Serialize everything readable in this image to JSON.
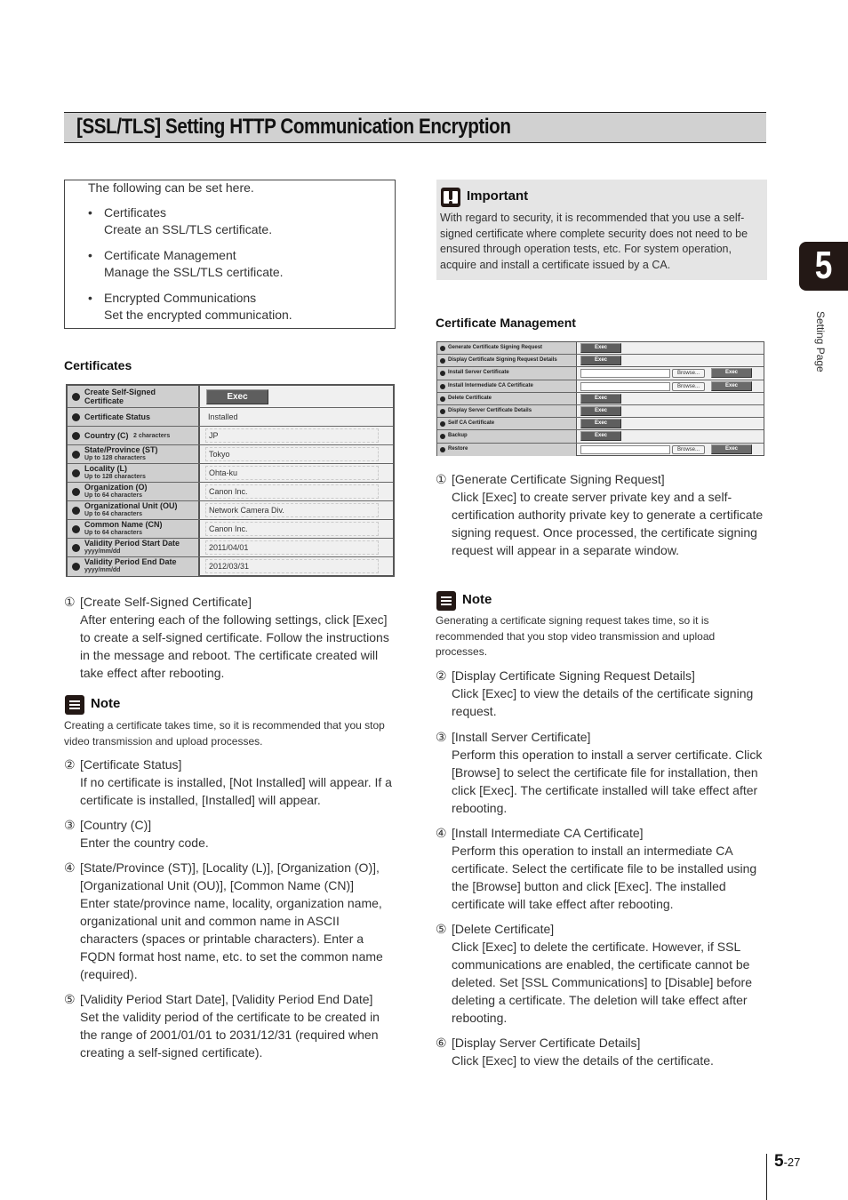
{
  "header": {
    "title": "[SSL/TLS] Setting HTTP Communication Encryption"
  },
  "chapter": {
    "number": "5",
    "side_label": "Setting Page"
  },
  "intro": {
    "lead": "The following can be set here.",
    "bullets": [
      {
        "title": "Certificates",
        "desc": "Create an SSL/TLS certificate."
      },
      {
        "title": "Certificate Management",
        "desc": "Manage the SSL/TLS certificate."
      },
      {
        "title": "Encrypted Communications",
        "desc": "Set the encrypted communication."
      }
    ]
  },
  "certificates": {
    "heading": "Certificates",
    "rows": [
      {
        "label": "Create Self-Signed",
        "label2": "Certificate",
        "sub": "",
        "type": "button",
        "value": "Exec"
      },
      {
        "label": "Certificate Status",
        "sub": "",
        "type": "text",
        "value": "Installed"
      },
      {
        "label": "Country (C)",
        "inline_sub": "2 characters",
        "sub": "",
        "type": "field",
        "value": "JP"
      },
      {
        "label": "State/Province (ST)",
        "sub": "Up to 128 characters",
        "type": "field",
        "value": "Tokyo"
      },
      {
        "label": "Locality (L)",
        "sub": "Up to 128 characters",
        "type": "field",
        "value": "Ohta-ku"
      },
      {
        "label": "Organization (O)",
        "sub": "Up to 64 characters",
        "type": "field",
        "value": "Canon Inc."
      },
      {
        "label": "Organizational Unit (OU)",
        "sub": "Up to 64 characters",
        "type": "field",
        "value": "Network Camera Div."
      },
      {
        "label": "Common Name (CN)",
        "sub": "Up to 64 characters",
        "type": "field",
        "value": "Canon Inc."
      },
      {
        "label": "Validity Period Start Date",
        "sub": "yyyy/mm/dd",
        "type": "field",
        "value": "2011/04/01"
      },
      {
        "label": "Validity Period End Date",
        "sub": "yyyy/mm/dd",
        "type": "field",
        "value": "2012/03/31"
      }
    ]
  },
  "left_items": [
    {
      "num": "①",
      "title": "[Create Self-Signed Certificate]",
      "body": "After entering each of the following settings, click [Exec] to create a self-signed certificate. Follow the instructions in the message and reboot. The certificate created will take effect after rebooting."
    },
    {
      "num": "②",
      "title": "[Certificate Status]",
      "body": "If no certificate is installed, [Not Installed] will appear. If a certificate is installed, [Installed] will appear."
    },
    {
      "num": "③",
      "title": "[Country (C)]",
      "body": "Enter the country code."
    },
    {
      "num": "④",
      "title": "[State/Province (ST)], [Locality (L)], [Organization (O)], [Organizational Unit (OU)], [Common Name (CN)]",
      "body": "Enter state/province name, locality, organization name, organizational unit and common name in ASCII characters (spaces or printable characters). Enter a FQDN format host name, etc. to set the common name (required)."
    },
    {
      "num": "⑤",
      "title": "[Validity Period Start Date], [Validity Period End Date]",
      "body": "Set the validity period of the certificate to be created in the range of 2001/01/01 to 2031/12/31 (required when creating a self-signed certificate)."
    }
  ],
  "left_note": {
    "title": "Note",
    "text": "Creating a certificate takes time, so it is recommended that you stop video transmission and upload processes."
  },
  "important": {
    "title": "Important",
    "text": "With regard to security, it is recommended that you use a self-signed certificate where complete security does not need to be ensured through operation tests, etc. For system operation, acquire and install a certificate issued by a CA."
  },
  "cert_mgmt": {
    "heading": "Certificate Management",
    "browse_label": "Browse...",
    "exec_label": "Exec",
    "rows": [
      {
        "label": "Generate Certificate Signing Request",
        "type": "button"
      },
      {
        "label": "Display Certificate Signing Request Details",
        "type": "button"
      },
      {
        "label": "Install Server Certificate",
        "type": "file"
      },
      {
        "label": "Install Intermediate CA Certificate",
        "type": "file"
      },
      {
        "label": "Delete Certificate",
        "type": "button"
      },
      {
        "label": "Display Server Certificate Details",
        "type": "button"
      },
      {
        "label": "Self CA Certificate",
        "type": "button"
      },
      {
        "label": "Backup",
        "type": "button"
      },
      {
        "label": "Restore",
        "type": "file"
      }
    ]
  },
  "right_items": [
    {
      "num": "①",
      "title": "[Generate Certificate Signing Request]",
      "body": "Click [Exec] to create server private key and a self-certification authority private key to generate a certificate signing request. Once processed, the certificate signing request will appear in a separate window."
    },
    {
      "num": "②",
      "title": "[Display Certificate Signing Request Details]",
      "body": "Click [Exec] to view the details of the certificate signing request."
    },
    {
      "num": "③",
      "title": "[Install Server Certificate]",
      "body": "Perform this operation to install a server certificate. Click [Browse] to select the certificate file for installation, then click [Exec]. The certificate installed will take effect after rebooting."
    },
    {
      "num": "④",
      "title": "[Install Intermediate CA Certificate]",
      "body": "Perform this operation to install an intermediate CA certificate. Select the certificate file to be installed using the [Browse] button and click [Exec]. The installed certificate will take effect after rebooting."
    },
    {
      "num": "⑤",
      "title": "[Delete Certificate]",
      "body": "Click [Exec] to delete the certificate. However, if SSL communications are enabled, the certificate cannot be deleted. Set [SSL Communications] to [Disable] before deleting a certificate. The deletion will take effect after rebooting."
    },
    {
      "num": "⑥",
      "title": "[Display Server Certificate Details]",
      "body": "Click [Exec] to view the details of the certificate."
    }
  ],
  "right_note": {
    "title": "Note",
    "text": "Generating a certificate signing request takes time, so it is recommended that you stop video transmission and upload processes."
  },
  "footer": {
    "chapter": "5",
    "page": "-27"
  }
}
